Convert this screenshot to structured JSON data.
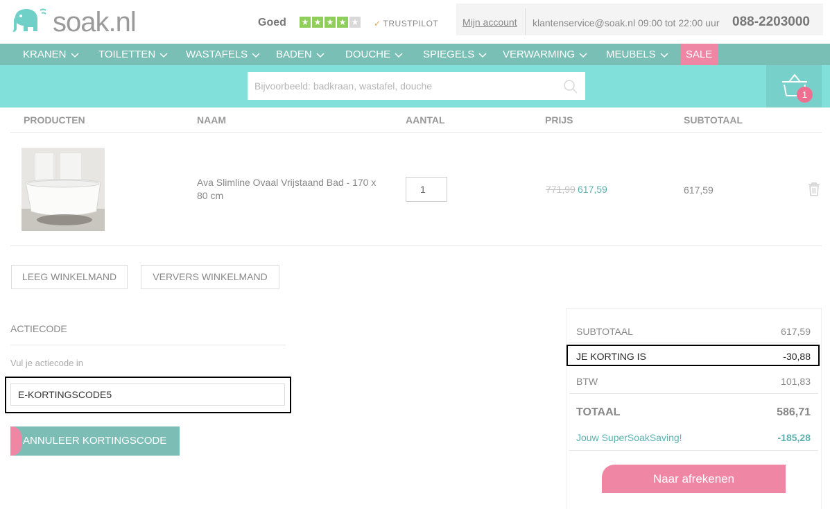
{
  "header": {
    "logo_text": "soak.nl",
    "rating_label": "Goed",
    "stars_filled": 4,
    "stars_total": 5,
    "trustpilot_label": "TRUSTPILOT",
    "account_link": "Mijn account",
    "service_text": "klantenservice@soak.nl 09:00 tot 22:00 uur",
    "phone": "088-2203000"
  },
  "nav": {
    "items": [
      {
        "label": "KRANEN"
      },
      {
        "label": "TOILETTEN"
      },
      {
        "label": "WASTAFELS"
      },
      {
        "label": "BADEN"
      },
      {
        "label": "DOUCHE"
      },
      {
        "label": "SPIEGELS"
      },
      {
        "label": "VERWARMING"
      },
      {
        "label": "MEUBELS"
      }
    ],
    "sale_label": "SALE"
  },
  "search": {
    "placeholder": "Bijvoorbeeld: badkraan, wastafel, douche"
  },
  "cart": {
    "count": "1"
  },
  "table": {
    "headers": [
      "PRODUCTEN",
      "NAAM",
      "AANTAL",
      "PRIJS",
      "SUBTOTAAL"
    ],
    "rows": [
      {
        "name": "Ava Slimline Ovaal Vrijstaand Bad - 170 x 80 cm",
        "quantity": "1",
        "old_price": "771,99",
        "price": "617,59",
        "subtotal": "617,59"
      }
    ]
  },
  "buttons": {
    "empty_cart": "LEEG WINKELMAND",
    "refresh_cart": "VERVERS WINKELMAND"
  },
  "actiecode": {
    "title": "ACTIECODE",
    "hint": "Vul je actiecode in",
    "value": "E-KORTINGSCODE5",
    "cancel_label": "ANNULEER KORTINGSCODE"
  },
  "totals": {
    "subtotal_label": "SUBTOTAAL",
    "subtotal_value": "617,59",
    "discount_label": "JE KORTING IS",
    "discount_value": "-30,88",
    "btw_label": "BTW",
    "btw_value": "101,83",
    "total_label": "TOTAAL",
    "total_value": "586,71",
    "saving_label": "Jouw SuperSoakSaving!",
    "saving_value": "-185,28",
    "checkout_label": "Naar afrekenen"
  },
  "colors": {
    "teal_nav": "#79bfb5",
    "search_band": "#82e0da",
    "pink_accent": "#ee86a4",
    "price_teal": "#5ab1b1"
  }
}
